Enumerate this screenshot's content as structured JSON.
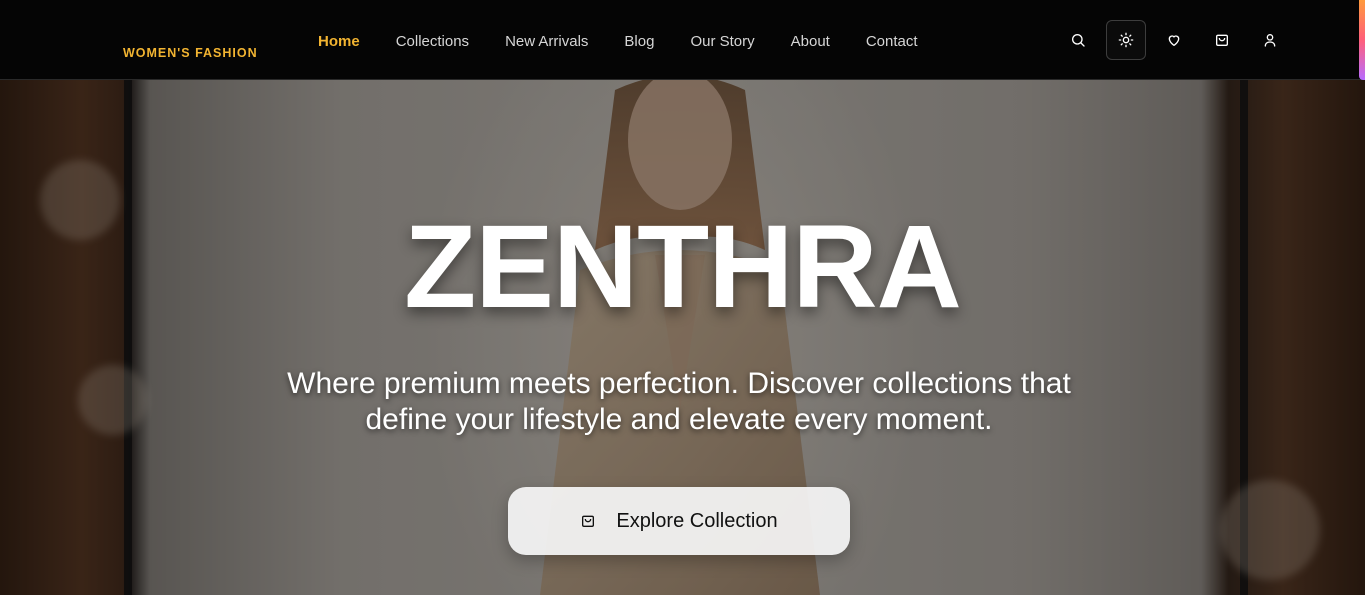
{
  "header": {
    "brand": "WOMEN'S FASHION",
    "nav": [
      {
        "label": "Home",
        "active": true
      },
      {
        "label": "Collections",
        "active": false
      },
      {
        "label": "New Arrivals",
        "active": false
      },
      {
        "label": "Blog",
        "active": false
      },
      {
        "label": "Our Story",
        "active": false
      },
      {
        "label": "About",
        "active": false
      },
      {
        "label": "Contact",
        "active": false
      }
    ],
    "icons": [
      "search-icon",
      "sun-icon",
      "heart-icon",
      "shopping-bag-icon",
      "user-icon"
    ]
  },
  "hero": {
    "title": "ZENTHRA",
    "subtitle_line1": "Where premium meets perfection. Discover collections that",
    "subtitle_line2": "define your lifestyle and elevate every moment.",
    "cta_label": "Explore Collection",
    "cta_icon": "shopping-bag-icon"
  },
  "colors": {
    "accent": "#f2b431",
    "navbar_bg": "#050505",
    "cta_bg": "#f5f5f5"
  }
}
